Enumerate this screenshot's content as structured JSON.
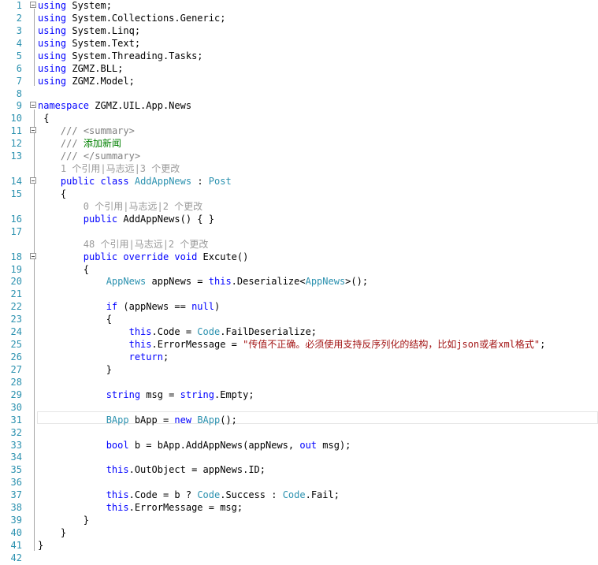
{
  "editor": {
    "lines": [
      {
        "no": "1",
        "tokens": [
          {
            "t": "using",
            "c": "kw"
          },
          {
            "t": " System;"
          }
        ]
      },
      {
        "no": "2",
        "tokens": [
          {
            "t": "using",
            "c": "kw"
          },
          {
            "t": " System.Collections.Generic;"
          }
        ]
      },
      {
        "no": "3",
        "tokens": [
          {
            "t": "using",
            "c": "kw"
          },
          {
            "t": " System.Linq;"
          }
        ]
      },
      {
        "no": "4",
        "tokens": [
          {
            "t": "using",
            "c": "kw"
          },
          {
            "t": " System.Text;"
          }
        ]
      },
      {
        "no": "5",
        "tokens": [
          {
            "t": "using",
            "c": "kw"
          },
          {
            "t": " System.Threading.Tasks;"
          }
        ]
      },
      {
        "no": "6",
        "tokens": [
          {
            "t": "using",
            "c": "kw"
          },
          {
            "t": " ZGMZ.BLL;"
          }
        ]
      },
      {
        "no": "7",
        "tokens": [
          {
            "t": "using",
            "c": "kw"
          },
          {
            "t": " ZGMZ.Model;"
          }
        ]
      },
      {
        "no": "8",
        "tokens": []
      },
      {
        "no": "9",
        "tokens": [
          {
            "t": "namespace",
            "c": "kw"
          },
          {
            "t": " ZGMZ.UIL.App.News"
          }
        ]
      },
      {
        "no": "10",
        "tokens": [
          {
            "t": " {"
          }
        ]
      },
      {
        "no": "11",
        "tokens": [
          {
            "t": "    "
          },
          {
            "t": "///",
            "c": "cg"
          },
          {
            "t": " ",
            "c": "cm"
          },
          {
            "t": "<summary>",
            "c": "cg"
          }
        ]
      },
      {
        "no": "12",
        "tokens": [
          {
            "t": "    "
          },
          {
            "t": "///",
            "c": "cg"
          },
          {
            "t": " 添加新闻",
            "c": "cm"
          }
        ]
      },
      {
        "no": "13",
        "tokens": [
          {
            "t": "    "
          },
          {
            "t": "///",
            "c": "cg"
          },
          {
            "t": " ",
            "c": "cm"
          },
          {
            "t": "</summary>",
            "c": "cg"
          }
        ]
      },
      {
        "lens": "    1 个引用|马志远|3 个更改"
      },
      {
        "no": "14",
        "tokens": [
          {
            "t": "    "
          },
          {
            "t": "public",
            "c": "kw"
          },
          {
            "t": " "
          },
          {
            "t": "class",
            "c": "kw"
          },
          {
            "t": " "
          },
          {
            "t": "AddAppNews",
            "c": "ty"
          },
          {
            "t": " : "
          },
          {
            "t": "Post",
            "c": "ty"
          }
        ]
      },
      {
        "no": "15",
        "tokens": [
          {
            "t": "    {"
          }
        ]
      },
      {
        "lens": "        0 个引用|马志远|2 个更改"
      },
      {
        "no": "16",
        "tokens": [
          {
            "t": "        "
          },
          {
            "t": "public",
            "c": "kw"
          },
          {
            "t": " AddAppNews() { }"
          }
        ]
      },
      {
        "no": "17",
        "tokens": []
      },
      {
        "lens": "        48 个引用|马志远|2 个更改"
      },
      {
        "no": "18",
        "tokens": [
          {
            "t": "        "
          },
          {
            "t": "public",
            "c": "kw"
          },
          {
            "t": " "
          },
          {
            "t": "override",
            "c": "kw"
          },
          {
            "t": " "
          },
          {
            "t": "void",
            "c": "kw"
          },
          {
            "t": " Excute()"
          }
        ]
      },
      {
        "no": "19",
        "tokens": [
          {
            "t": "        {"
          }
        ]
      },
      {
        "no": "20",
        "tokens": [
          {
            "t": "            "
          },
          {
            "t": "AppNews",
            "c": "ty"
          },
          {
            "t": " appNews = "
          },
          {
            "t": "this",
            "c": "kw"
          },
          {
            "t": ".Deserialize<"
          },
          {
            "t": "AppNews",
            "c": "ty"
          },
          {
            "t": ">();"
          }
        ]
      },
      {
        "no": "21",
        "tokens": []
      },
      {
        "no": "22",
        "tokens": [
          {
            "t": "            "
          },
          {
            "t": "if",
            "c": "kw"
          },
          {
            "t": " (appNews == "
          },
          {
            "t": "null",
            "c": "kw"
          },
          {
            "t": ")"
          }
        ]
      },
      {
        "no": "23",
        "tokens": [
          {
            "t": "            {"
          }
        ]
      },
      {
        "no": "24",
        "tokens": [
          {
            "t": "                "
          },
          {
            "t": "this",
            "c": "kw"
          },
          {
            "t": ".Code = "
          },
          {
            "t": "Code",
            "c": "ty"
          },
          {
            "t": ".FailDeserialize;"
          }
        ]
      },
      {
        "no": "25",
        "tokens": [
          {
            "t": "                "
          },
          {
            "t": "this",
            "c": "kw"
          },
          {
            "t": ".ErrorMessage = "
          },
          {
            "t": "\"传值不正确。必须使用支持反序列化的结构，比如json或者xml格式\"",
            "c": "str"
          },
          {
            "t": ";"
          }
        ]
      },
      {
        "no": "26",
        "tokens": [
          {
            "t": "                "
          },
          {
            "t": "return",
            "c": "kw"
          },
          {
            "t": ";"
          }
        ]
      },
      {
        "no": "27",
        "tokens": [
          {
            "t": "            }"
          }
        ]
      },
      {
        "no": "28",
        "tokens": []
      },
      {
        "no": "29",
        "tokens": [
          {
            "t": "            "
          },
          {
            "t": "string",
            "c": "kw"
          },
          {
            "t": " msg = "
          },
          {
            "t": "string",
            "c": "kw"
          },
          {
            "t": ".Empty;"
          }
        ]
      },
      {
        "no": "30",
        "tokens": []
      },
      {
        "no": "31",
        "tokens": [
          {
            "t": "            "
          },
          {
            "t": "BApp",
            "c": "ty"
          },
          {
            "t": " bApp = "
          },
          {
            "t": "new",
            "c": "kw"
          },
          {
            "t": " "
          },
          {
            "t": "BApp",
            "c": "ty"
          },
          {
            "t": "();"
          }
        ]
      },
      {
        "no": "32",
        "tokens": []
      },
      {
        "no": "33",
        "tokens": [
          {
            "t": "            "
          },
          {
            "t": "bool",
            "c": "kw"
          },
          {
            "t": " b = bApp.AddAppNews(appNews, "
          },
          {
            "t": "out",
            "c": "kw"
          },
          {
            "t": " msg);"
          }
        ]
      },
      {
        "no": "34",
        "tokens": []
      },
      {
        "no": "35",
        "tokens": [
          {
            "t": "            "
          },
          {
            "t": "this",
            "c": "kw"
          },
          {
            "t": ".OutObject = appNews.ID;"
          }
        ]
      },
      {
        "no": "36",
        "tokens": []
      },
      {
        "no": "37",
        "tokens": [
          {
            "t": "            "
          },
          {
            "t": "this",
            "c": "kw"
          },
          {
            "t": ".Code = b ? "
          },
          {
            "t": "Code",
            "c": "ty"
          },
          {
            "t": ".Success : "
          },
          {
            "t": "Code",
            "c": "ty"
          },
          {
            "t": ".Fail;"
          }
        ]
      },
      {
        "no": "38",
        "tokens": [
          {
            "t": "            "
          },
          {
            "t": "this",
            "c": "kw"
          },
          {
            "t": ".ErrorMessage = msg;"
          }
        ]
      },
      {
        "no": "39",
        "tokens": [
          {
            "t": "        }"
          }
        ]
      },
      {
        "no": "40",
        "tokens": [
          {
            "t": "    }"
          }
        ]
      },
      {
        "no": "41",
        "tokens": [
          {
            "t": "}"
          }
        ]
      },
      {
        "no": "42",
        "tokens": []
      }
    ],
    "fold_rows": [
      "1",
      "9",
      "11",
      "14",
      "18"
    ],
    "current_line": "31"
  }
}
